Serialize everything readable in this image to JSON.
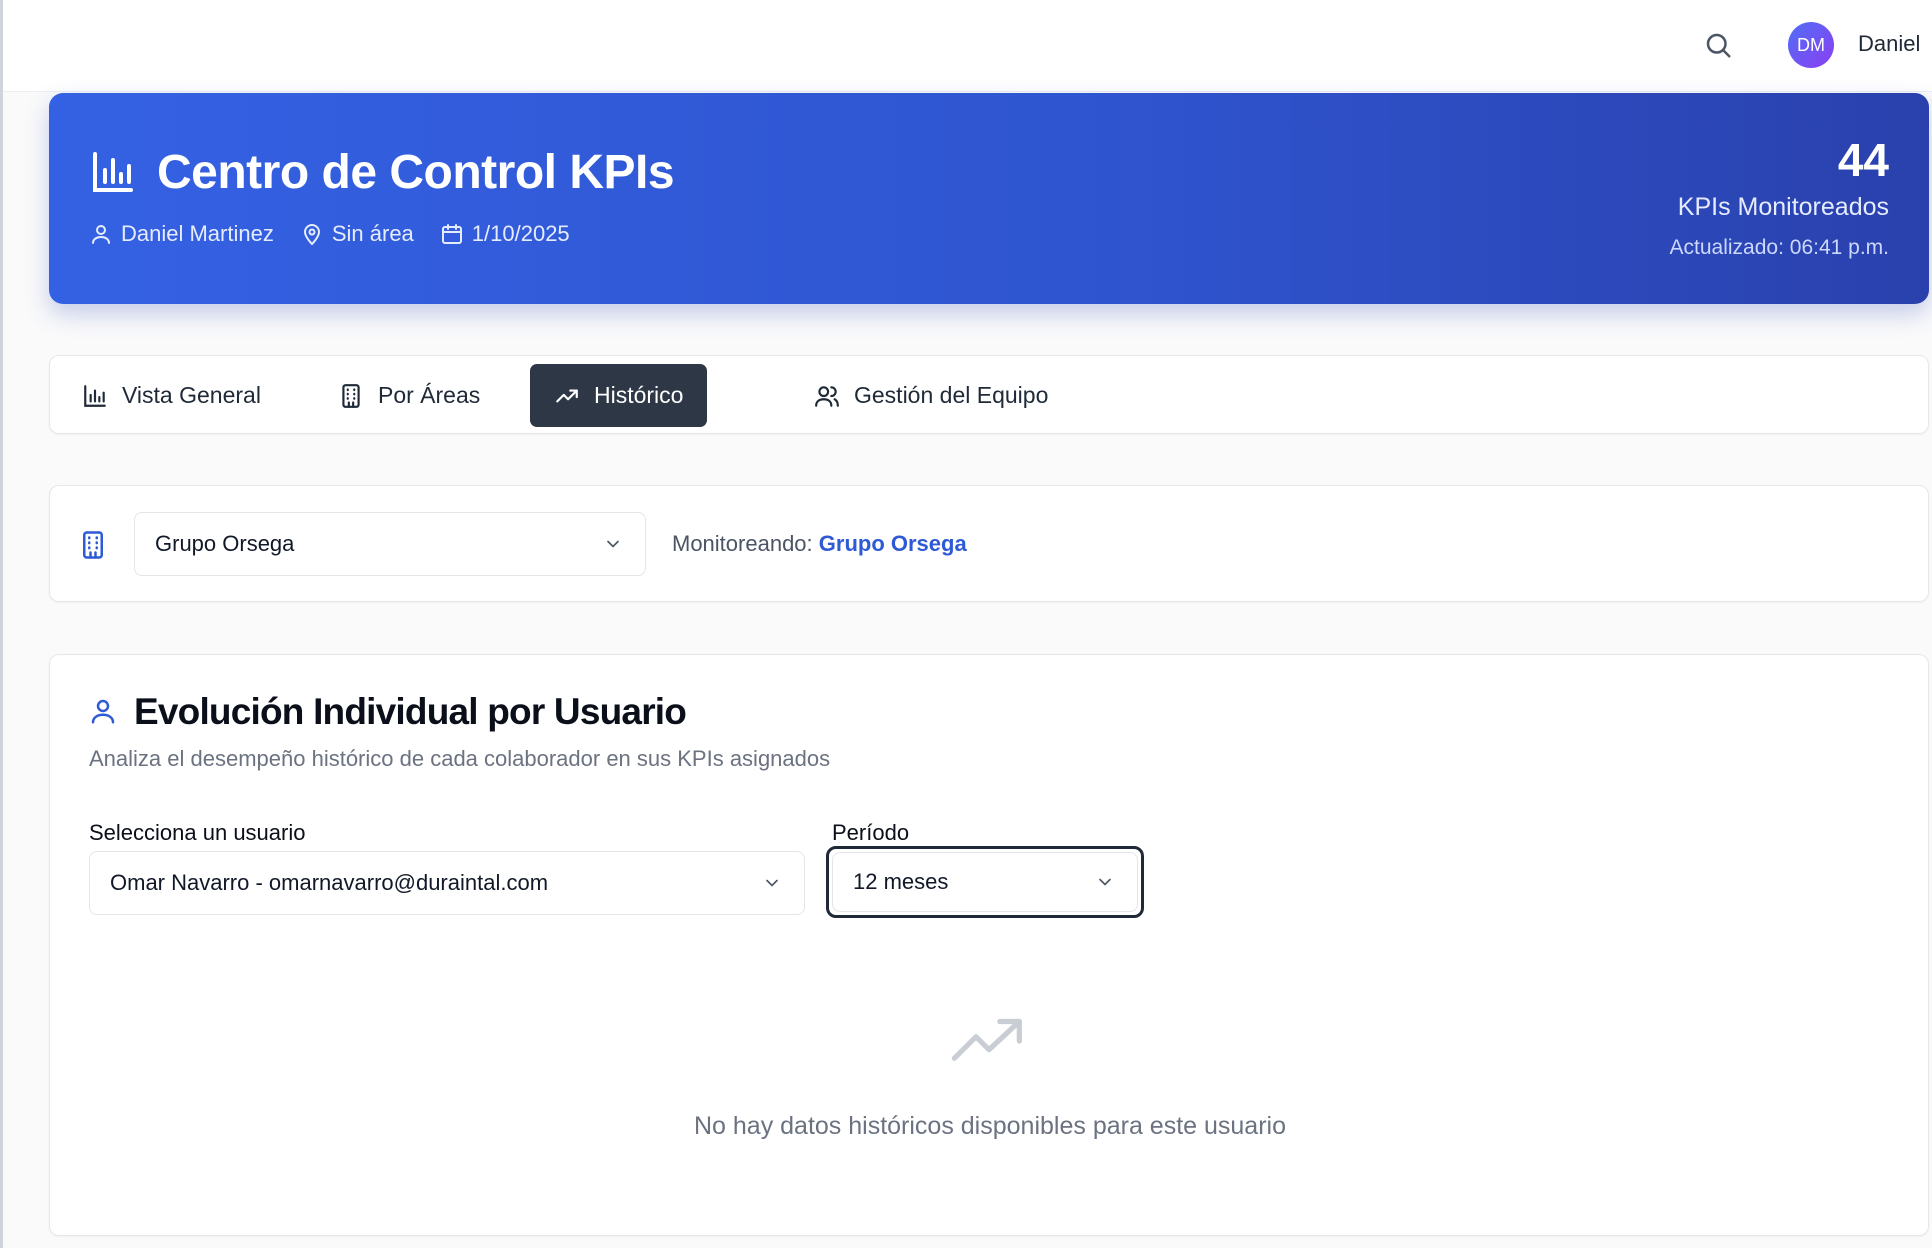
{
  "topbar": {
    "avatar_initials": "DM",
    "user_name": "Daniel"
  },
  "hero": {
    "title": "Centro de Control KPIs",
    "user": "Daniel Martinez",
    "area": "Sin área",
    "date": "1/10/2025",
    "kpi_count": "44",
    "kpi_count_label": "KPIs Monitoreados",
    "updated": "Actualizado: 06:41 p.m."
  },
  "tabs": [
    {
      "label": "Vista General",
      "icon": "bar-chart-icon",
      "active": false
    },
    {
      "label": "Por Áreas",
      "icon": "building-icon",
      "active": false
    },
    {
      "label": "Histórico",
      "icon": "trending-up-icon",
      "active": true
    },
    {
      "label": "Gestión del Equipo",
      "icon": "users-icon",
      "active": false
    }
  ],
  "org_selector": {
    "selected": "Grupo Orsega",
    "monitor_prefix": "Monitoreando:",
    "monitor_value": "Grupo Orsega"
  },
  "section": {
    "title": "Evolución Individual por Usuario",
    "subtitle": "Analiza el desempeño histórico de cada colaborador en sus KPIs asignados",
    "user_label": "Selecciona un usuario",
    "user_value": "Omar Navarro - omarnavarro@duraintal.com",
    "period_label": "Período",
    "period_value": "12 meses",
    "empty_message": "No hay datos históricos disponibles para este usuario"
  },
  "colors": {
    "accent": "#2f5ad6",
    "hero_start": "#3461e3",
    "hero_end": "#2a41ad",
    "active_tab": "#2d3746"
  }
}
